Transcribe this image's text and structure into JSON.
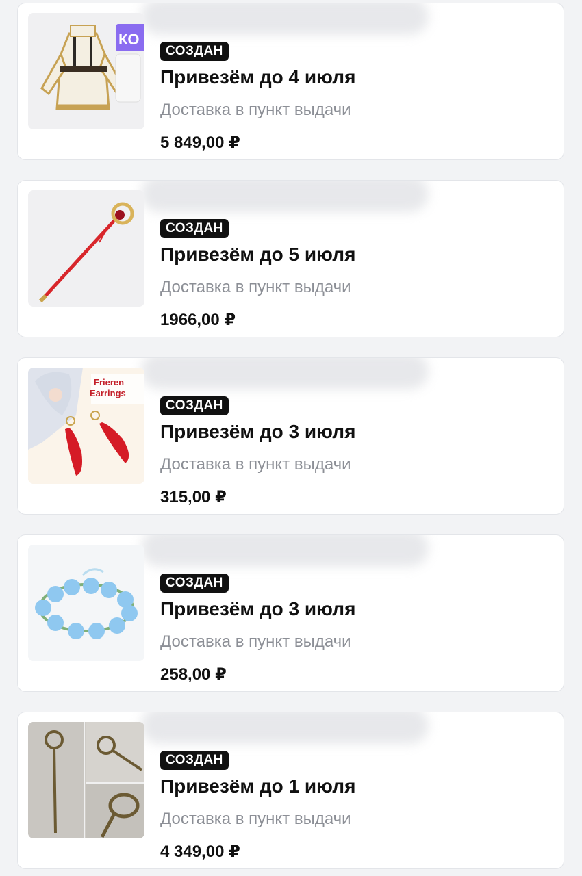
{
  "orders": [
    {
      "status": "СОЗДАН",
      "delivery_title": "Привезём до 4 июля",
      "delivery_method": "Доставка в пункт выдачи",
      "price": "5 849,00 ₽",
      "thumb_label": "КО"
    },
    {
      "status": "СОЗДАН",
      "delivery_title": "Привезём до 5 июля",
      "delivery_method": "Доставка в пункт выдачи",
      "price": "1966,00 ₽"
    },
    {
      "status": "СОЗДАН",
      "delivery_title": "Привезём до 3 июля",
      "delivery_method": "Доставка в пункт выдачи",
      "price": "315,00 ₽",
      "thumb_label_1": "Frieren",
      "thumb_label_2": "Earrings"
    },
    {
      "status": "СОЗДАН",
      "delivery_title": "Привезём до 3 июля",
      "delivery_method": "Доставка в пункт выдачи",
      "price": "258,00 ₽"
    },
    {
      "status": "СОЗДАН",
      "delivery_title": "Привезём до 1 июля",
      "delivery_method": "Доставка в пункт выдачи",
      "price": "4 349,00 ₽"
    }
  ]
}
